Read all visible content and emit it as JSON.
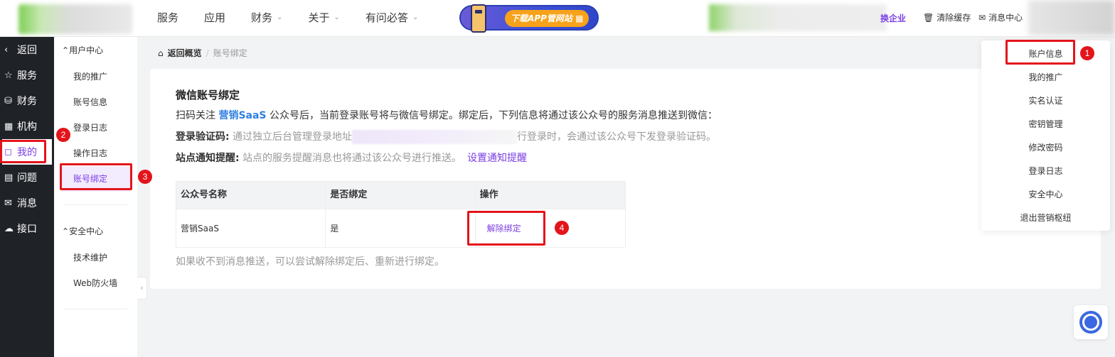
{
  "topnav": {
    "items": [
      {
        "label": "服务",
        "has_dropdown": false
      },
      {
        "label": "应用",
        "has_dropdown": false
      },
      {
        "label": "财务",
        "has_dropdown": true
      },
      {
        "label": "关于",
        "has_dropdown": true
      },
      {
        "label": "有问必答",
        "has_dropdown": true
      }
    ],
    "app_banner": "下载APP管网站",
    "switch_enterprise": "换企业",
    "clear_cache": "清除缓存",
    "message_center": "消息中心"
  },
  "sidebar": {
    "items": [
      {
        "label": "返回",
        "icon": "back-icon"
      },
      {
        "label": "服务",
        "icon": "star-icon"
      },
      {
        "label": "财务",
        "icon": "database-icon"
      },
      {
        "label": "机构",
        "icon": "building-icon"
      },
      {
        "label": "我的",
        "icon": "bookmark-icon",
        "active": true
      },
      {
        "label": "问题",
        "icon": "document-icon"
      },
      {
        "label": "消息",
        "icon": "mail-icon"
      },
      {
        "label": "接口",
        "icon": "cloud-icon"
      }
    ]
  },
  "subnav": {
    "group1": "用户中心",
    "group1_items": [
      "我的推广",
      "账号信息",
      "登录日志",
      "操作日志",
      "账号绑定"
    ],
    "group2": "安全中心",
    "group2_items": [
      "技术维护",
      "Web防火墙"
    ]
  },
  "breadcrumb": {
    "home": "返回概览",
    "current": "账号绑定"
  },
  "content": {
    "title": "微信账号绑定",
    "line1_pre": "扫码关注 ",
    "line1_brand": "营销SaaS",
    "line1_post": " 公众号后，当前登录账号将与微信号绑定。绑定后，下列信息将通过该公众号的服务消息推送到微信：",
    "line2_label": "登录验证码:",
    "line2_pre": " 通过独立后台管理登录地址",
    "line2_post": "行登录时，会通过该公众号下发登录验证码。",
    "line3_label": "站点通知提醒:",
    "line3_text": " 站点的服务提醒消息也将通过该公众号进行推送。",
    "line3_link": "设置通知提醒",
    "table": {
      "headers": [
        "公众号名称",
        "是否绑定",
        "操作"
      ],
      "row": {
        "name": "营销SaaS",
        "bound": "是",
        "action": "解除绑定"
      }
    },
    "hint": "如果收不到消息推送，可以尝试解除绑定后、重新进行绑定。"
  },
  "dropdown": {
    "items": [
      "账户信息",
      "我的推广",
      "实名认证",
      "密钥管理",
      "修改密码",
      "登录日志",
      "安全中心",
      "退出营销枢纽"
    ]
  },
  "badges": [
    "1",
    "2",
    "3",
    "4"
  ],
  "colors": {
    "accent": "#7b3fe4",
    "highlight": "#e4141b",
    "sidebar_bg": "#1f2227",
    "brand_link": "#2f7fe0"
  }
}
